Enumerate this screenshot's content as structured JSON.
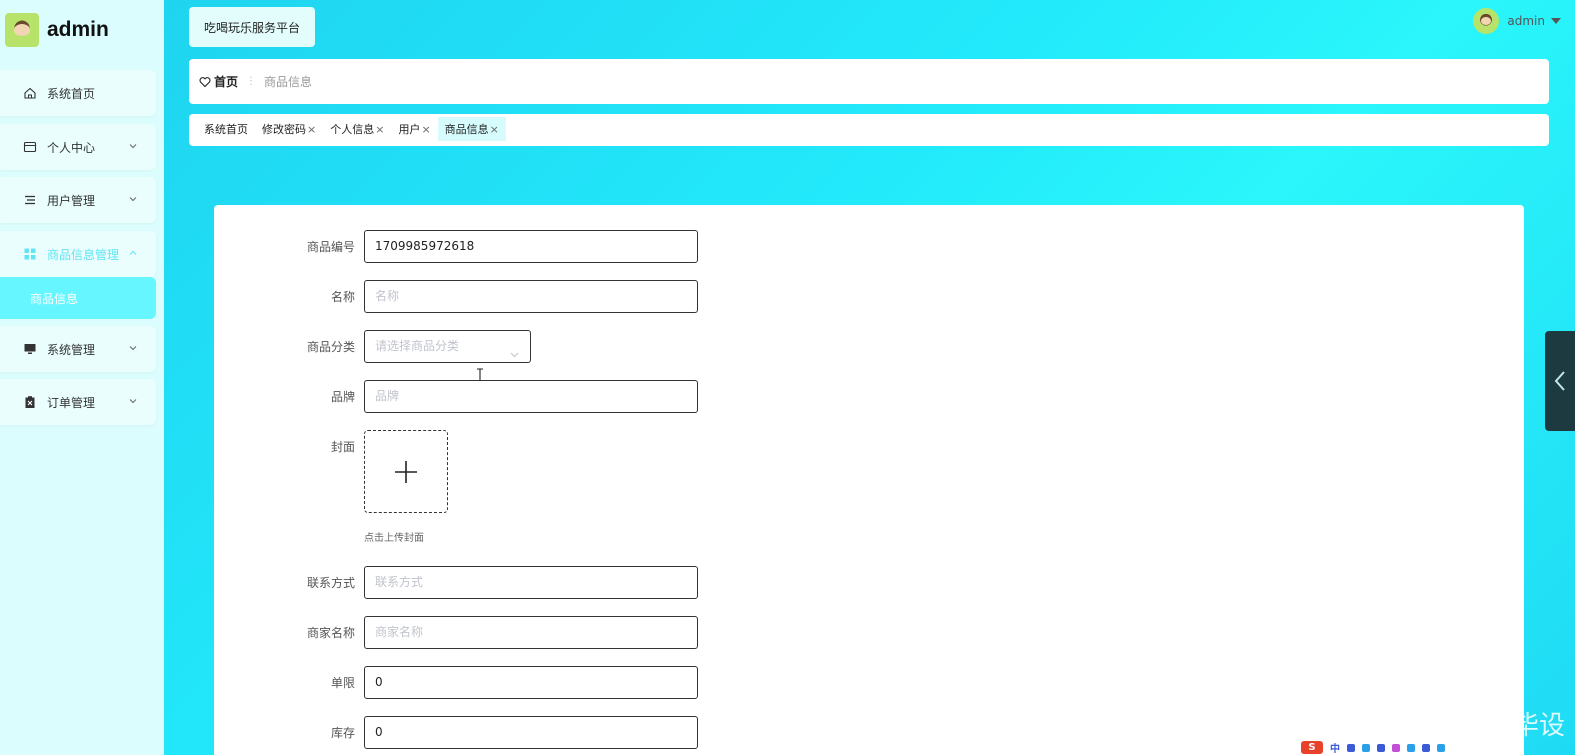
{
  "brand": {
    "title": "admin"
  },
  "sidebar": {
    "items": [
      {
        "label": "系统首页",
        "icon": "home-icon"
      },
      {
        "label": "个人中心",
        "icon": "id-card-icon"
      },
      {
        "label": "用户管理",
        "icon": "list-icon"
      },
      {
        "label": "商品信息管理",
        "icon": "grid-icon",
        "active": true
      },
      {
        "label": "系统管理",
        "icon": "monitor-icon"
      },
      {
        "label": "订单管理",
        "icon": "clipboard-icon"
      }
    ],
    "sub_item": {
      "label": "商品信息"
    }
  },
  "header": {
    "platform_name": "吃喝玩乐服务平台",
    "user_name": "admin"
  },
  "breadcrumb": {
    "home": "首页",
    "current": "商品信息"
  },
  "tabs": [
    {
      "label": "系统首页",
      "closable": false
    },
    {
      "label": "修改密码",
      "closable": true
    },
    {
      "label": "个人信息",
      "closable": true
    },
    {
      "label": "用户",
      "closable": true
    },
    {
      "label": "商品信息",
      "closable": true,
      "active": true
    }
  ],
  "tab_close_glyph": "×",
  "form": {
    "product_no": {
      "label": "商品编号",
      "value": "1709985972618"
    },
    "name": {
      "label": "名称",
      "placeholder": "名称"
    },
    "category": {
      "label": "商品分类",
      "placeholder": "请选择商品分类"
    },
    "brand": {
      "label": "品牌",
      "placeholder": "品牌"
    },
    "cover": {
      "label": "封面",
      "hint": "点击上传封面"
    },
    "contact": {
      "label": "联系方式",
      "placeholder": "联系方式"
    },
    "merchant": {
      "label": "商家名称",
      "placeholder": "商家名称"
    },
    "limit": {
      "label": "单限",
      "value": "0"
    },
    "stock": {
      "label": "库存",
      "value": "0"
    }
  },
  "watermark": "CSDN @亦月学姐毕设",
  "ime": {
    "logo": "S",
    "lang": "中"
  },
  "colors": {
    "sidebar_bg": "#dcfdfd",
    "active_menu_text": "#62e4f4",
    "submenu_bg": "#66f6ff",
    "main_gradient_start": "#1fd4f0",
    "main_gradient_end": "#2af6fb",
    "side_toggle": "#1d3a40"
  }
}
